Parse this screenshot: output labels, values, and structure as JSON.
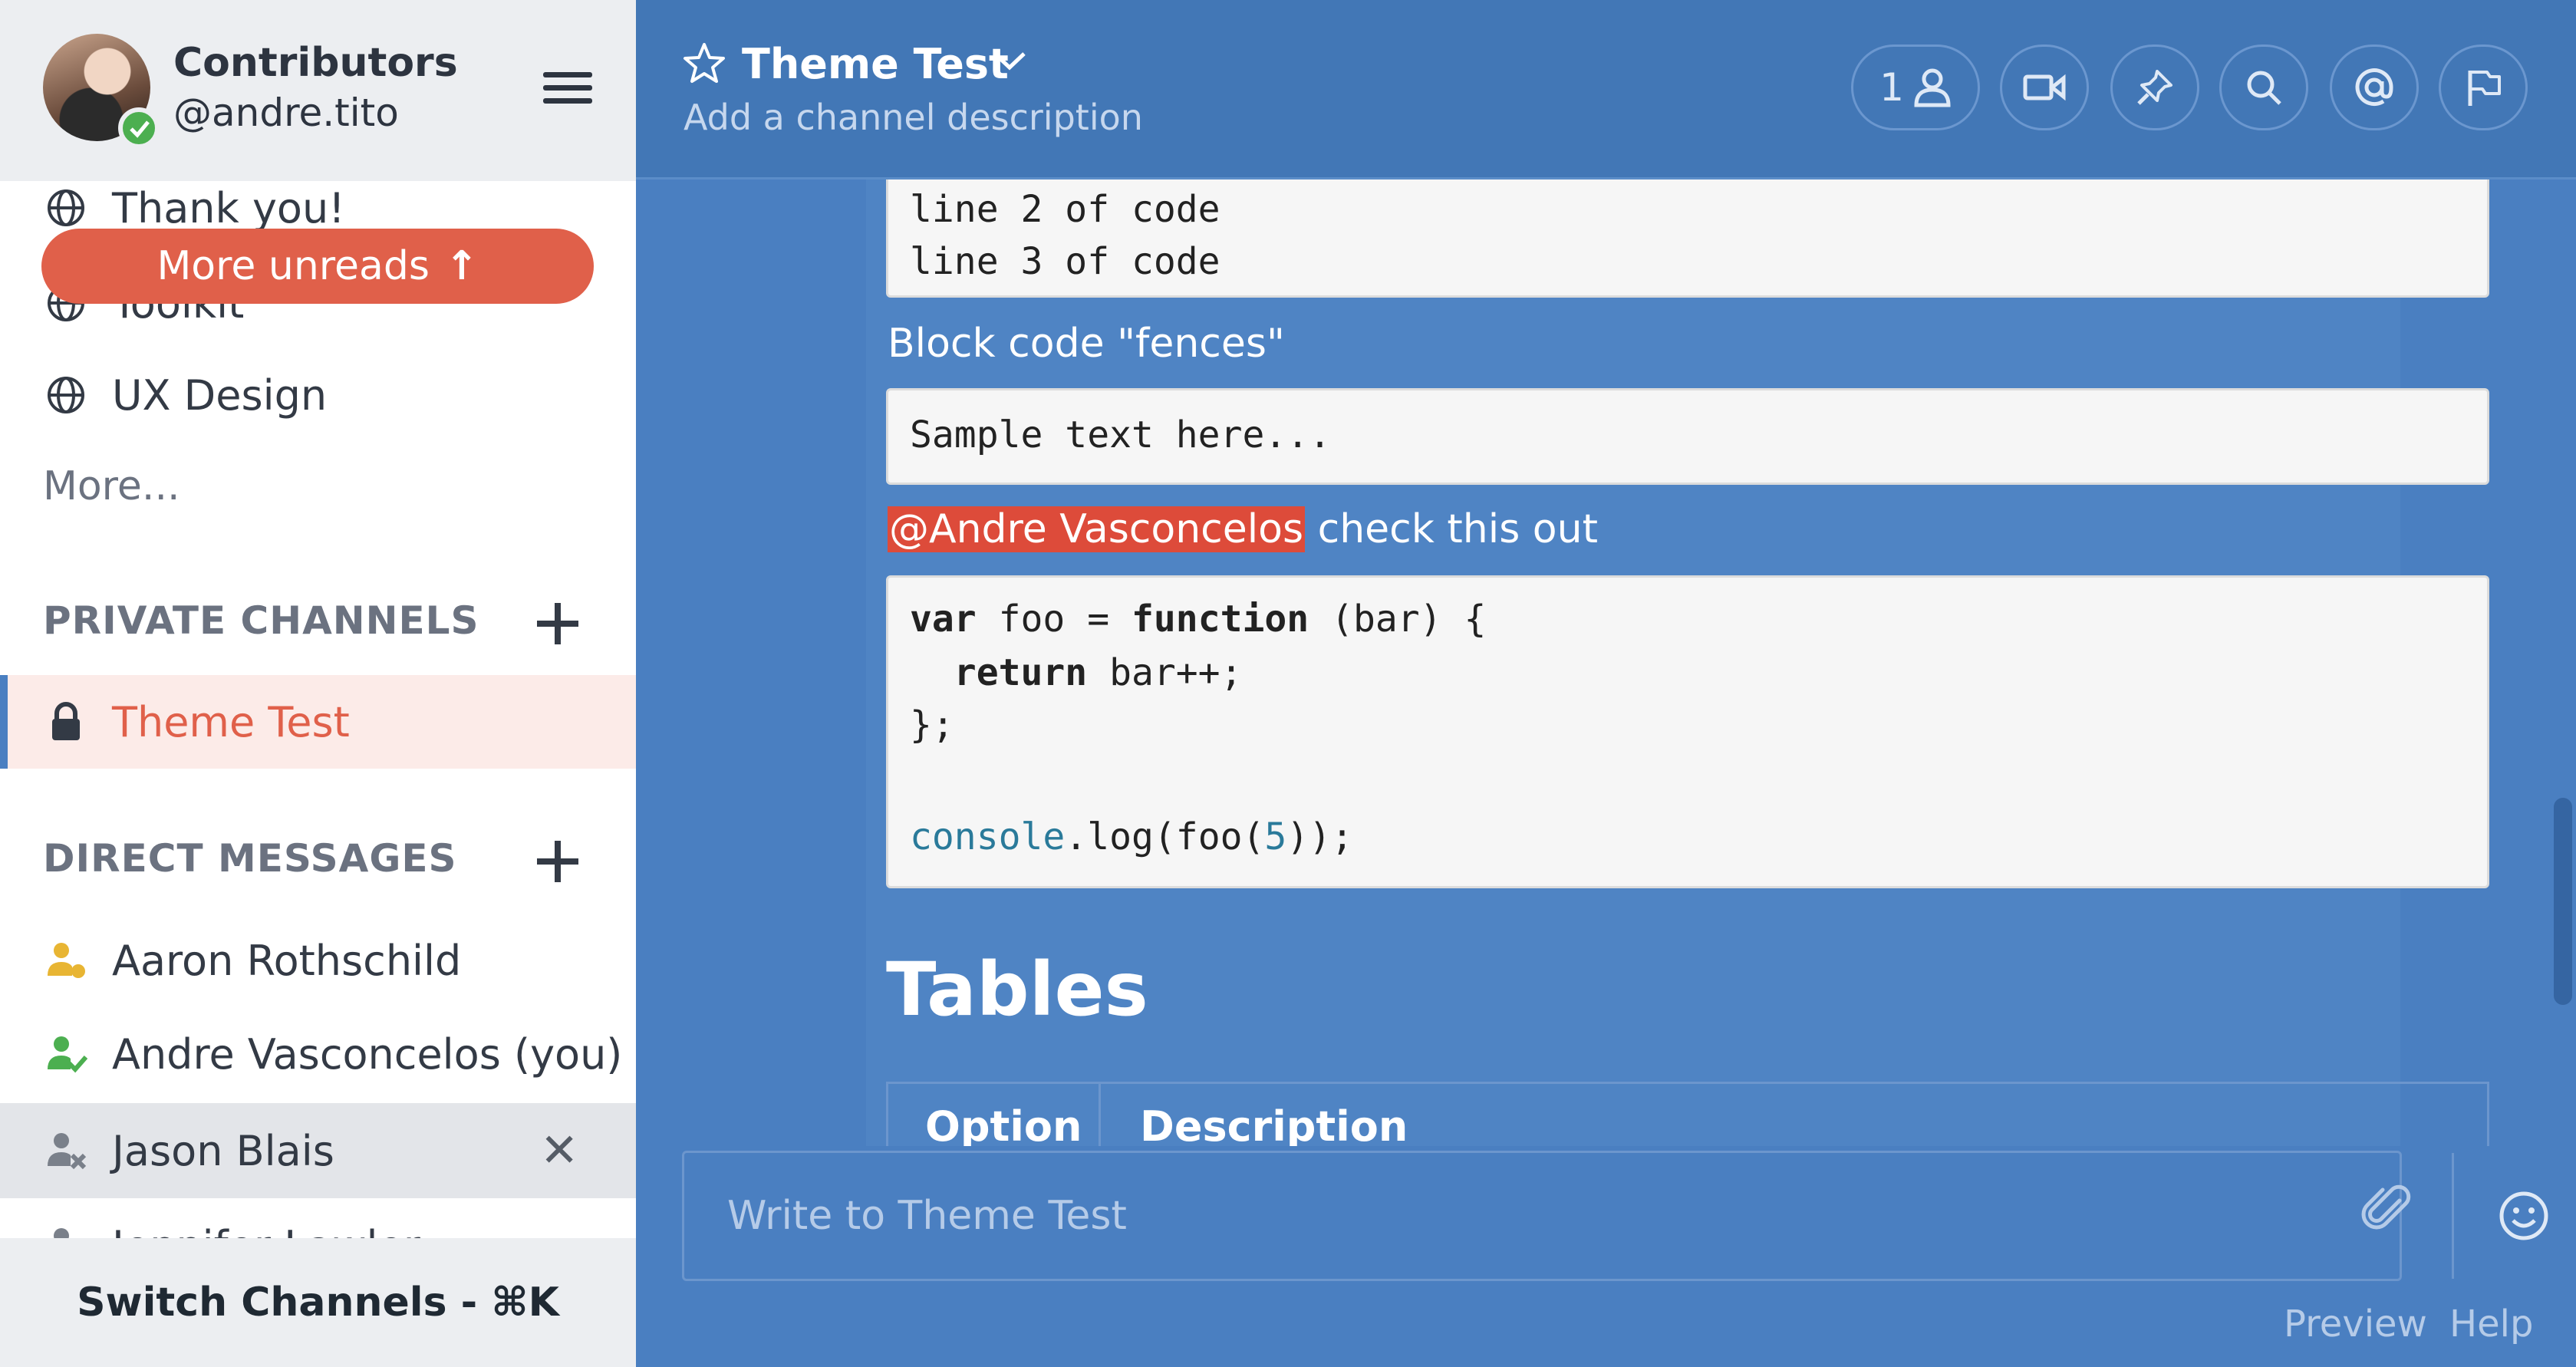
{
  "sidebar": {
    "team_name": "Contributors",
    "username": "@andre.tito",
    "channels_partial": [
      {
        "label": "Thank you!"
      },
      {
        "label": "Toolkit"
      },
      {
        "label": "UX Design"
      }
    ],
    "more_unreads": "More unreads",
    "more_link": "More...",
    "private_header": "PRIVATE CHANNELS",
    "private_channels": [
      {
        "label": "Theme Test",
        "active": true
      }
    ],
    "dm_header": "DIRECT MESSAGES",
    "direct_messages": [
      {
        "label": "Aaron Rothschild",
        "status": "away",
        "status_color": "#e8b533"
      },
      {
        "label": "Andre Vasconcelos (you)",
        "status": "online",
        "status_color": "#4caf50"
      },
      {
        "label": "Jason Blais",
        "status": "offline",
        "status_color": "#7a808a"
      },
      {
        "label": "Jennifer Lawler",
        "status": "offline",
        "status_color": "#7a808a"
      }
    ],
    "switch_channels": "Switch Channels - ⌘K"
  },
  "header": {
    "channel_title": "Theme Test",
    "channel_description": "Add a channel description",
    "member_count": "1",
    "icons": [
      "member-icon",
      "video-icon",
      "pin-icon",
      "search-icon",
      "mention-icon",
      "flag-icon"
    ]
  },
  "post": {
    "code_lines_top": [
      "line 2 of code",
      "line 3 of code"
    ],
    "fences_label": "Block code \"fences\"",
    "fence_sample": "Sample text here...",
    "mention": "@Andre Vasconcelos",
    "mention_rest": " check this out",
    "js_code": {
      "l1_kw1": "var",
      "l1_mid": " foo = ",
      "l1_kw2": "function",
      "l1_end": " (bar) {",
      "l2_kw": "return",
      "l2_end": " bar++;",
      "l3": "};",
      "l5_obj": "console",
      "l5_mid": ".log(foo(",
      "l5_num": "5",
      "l5_end": "));"
    },
    "tables_heading": "Tables",
    "table_headers": [
      "Option",
      "Description"
    ]
  },
  "composer": {
    "placeholder": "Write to Theme Test"
  },
  "footer": {
    "preview": "Preview",
    "help": "Help"
  },
  "colors": {
    "sidebar_bg": "#ffffff",
    "accent": "#e0604a",
    "main_bg": "#4a7fc1",
    "mention_bg": "#dd4b3a"
  }
}
